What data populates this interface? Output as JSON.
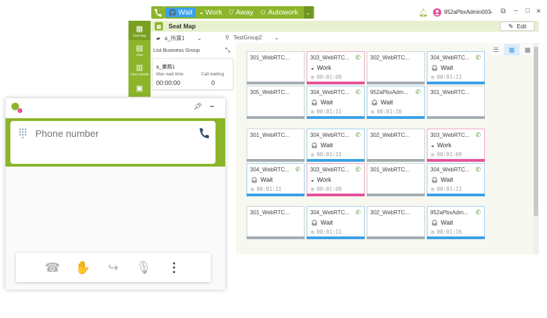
{
  "topbar": {
    "statuses": [
      {
        "label": "Wait",
        "icon": "headset-icon",
        "glyph": "🎧",
        "active": true
      },
      {
        "label": "Work",
        "icon": "circle-half-icon",
        "glyph": "◒",
        "active": false
      },
      {
        "label": "Away",
        "icon": "chair-icon",
        "glyph": "⛉",
        "active": false
      },
      {
        "label": "Autowork",
        "icon": "people-icon",
        "glyph": "⚇",
        "active": false
      }
    ],
    "user_name": "952aPbxAdmin003",
    "window_controls": {
      "restore": "⧉",
      "minimize": "–",
      "maximize": "□",
      "close": "✕"
    }
  },
  "ribbon": {
    "title": "Seat Map",
    "edit_label": "Edit"
  },
  "sidebar": [
    {
      "label": "Seat Map",
      "icon": "grid-icon",
      "glyph": "▦"
    },
    {
      "label": "Chat",
      "icon": "chat-icon",
      "glyph": "▤"
    },
    {
      "label": "Chat ListSide",
      "icon": "chat-list-icon",
      "glyph": "▥"
    },
    {
      "label": "",
      "icon": "contacts-icon",
      "glyph": "▣"
    }
  ],
  "filters": {
    "department": "a_所属1",
    "group": "TestGroup2"
  },
  "business_group": {
    "header": "List Business Group",
    "name": "a_業務1",
    "max_wait_label": "Max wait time",
    "max_wait_value": "00:00:00",
    "call_waiting_label": "Call waiting",
    "call_waiting_value": "0"
  },
  "colors": {
    "green": "#8cb52b",
    "blue": "#3aa0e8",
    "pink": "#e5539a",
    "gray": "#a3adb5"
  },
  "seat_groups": [
    {
      "rows": [
        [
          {
            "name": "301_WebRTC...",
            "status": "",
            "time": "",
            "color": "gray",
            "phone": false
          },
          {
            "name": "303_WebRTC...",
            "status": "Work",
            "time": "00:01:09",
            "color": "pink",
            "phone": true
          },
          {
            "name": "302_WebRTC...",
            "status": "",
            "time": "",
            "color": "gray",
            "phone": false
          },
          {
            "name": "304_WebRTC...",
            "status": "Wait",
            "time": "00:01:11",
            "color": "blue",
            "phone": true
          }
        ],
        [
          {
            "name": "305_WebRTC...",
            "status": "",
            "time": "",
            "color": "gray",
            "phone": false
          },
          {
            "name": "304_WebRTC...",
            "status": "Wait",
            "time": "00:01:11",
            "color": "blue",
            "phone": true
          },
          {
            "name": "952aPbxAdm...",
            "status": "Wait",
            "time": "00:01:16",
            "color": "blue",
            "phone": true
          },
          {
            "name": "301_WebRTC...",
            "status": "",
            "time": "",
            "color": "gray",
            "phone": false
          }
        ]
      ]
    },
    {
      "rows": [
        [
          {
            "name": "301_WebRTC...",
            "status": "",
            "time": "",
            "color": "gray",
            "phone": false
          },
          {
            "name": "304_WebRTC...",
            "status": "Wait",
            "time": "00:01:11",
            "color": "blue",
            "phone": true
          },
          {
            "name": "302_WebRTC...",
            "status": "",
            "time": "",
            "color": "gray",
            "phone": false
          },
          {
            "name": "303_WebRTC...",
            "status": "Work",
            "time": "00:01:09",
            "color": "pink",
            "phone": true
          }
        ],
        [
          {
            "name": "304_WebRTC...",
            "status": "Wait",
            "time": "00:01:11",
            "color": "blue",
            "phone": true
          },
          {
            "name": "303_WebRTC...",
            "status": "Work",
            "time": "00:01:09",
            "color": "pink",
            "phone": true
          },
          {
            "name": "301_WebRTC...",
            "status": "",
            "time": "",
            "color": "gray",
            "phone": false
          },
          {
            "name": "304_WebRTC...",
            "status": "Wait",
            "time": "00:01:11",
            "color": "blue",
            "phone": true
          }
        ]
      ]
    },
    {
      "rows": [
        [
          {
            "name": "301_WebRTC...",
            "status": "",
            "time": "",
            "color": "gray",
            "phone": false
          },
          {
            "name": "304_WebRTC...",
            "status": "Wait",
            "time": "00:01:11",
            "color": "blue",
            "phone": true
          },
          {
            "name": "302_WebRTC...",
            "status": "",
            "time": "",
            "color": "gray",
            "phone": false
          },
          {
            "name": "952aPbxAdm...",
            "status": "Wait",
            "time": "00:01:16",
            "color": "blue",
            "phone": true
          }
        ]
      ]
    }
  ],
  "phone": {
    "placeholder": "Phone number",
    "controls": [
      {
        "name": "hangup-icon",
        "glyph": "☎"
      },
      {
        "name": "hold-hand-icon",
        "glyph": "✋"
      },
      {
        "name": "transfer-call-icon",
        "glyph": "↪"
      },
      {
        "name": "microphone-icon",
        "glyph": "🎙"
      },
      {
        "name": "more-vertical-icon",
        "glyph": "⋮"
      }
    ]
  }
}
